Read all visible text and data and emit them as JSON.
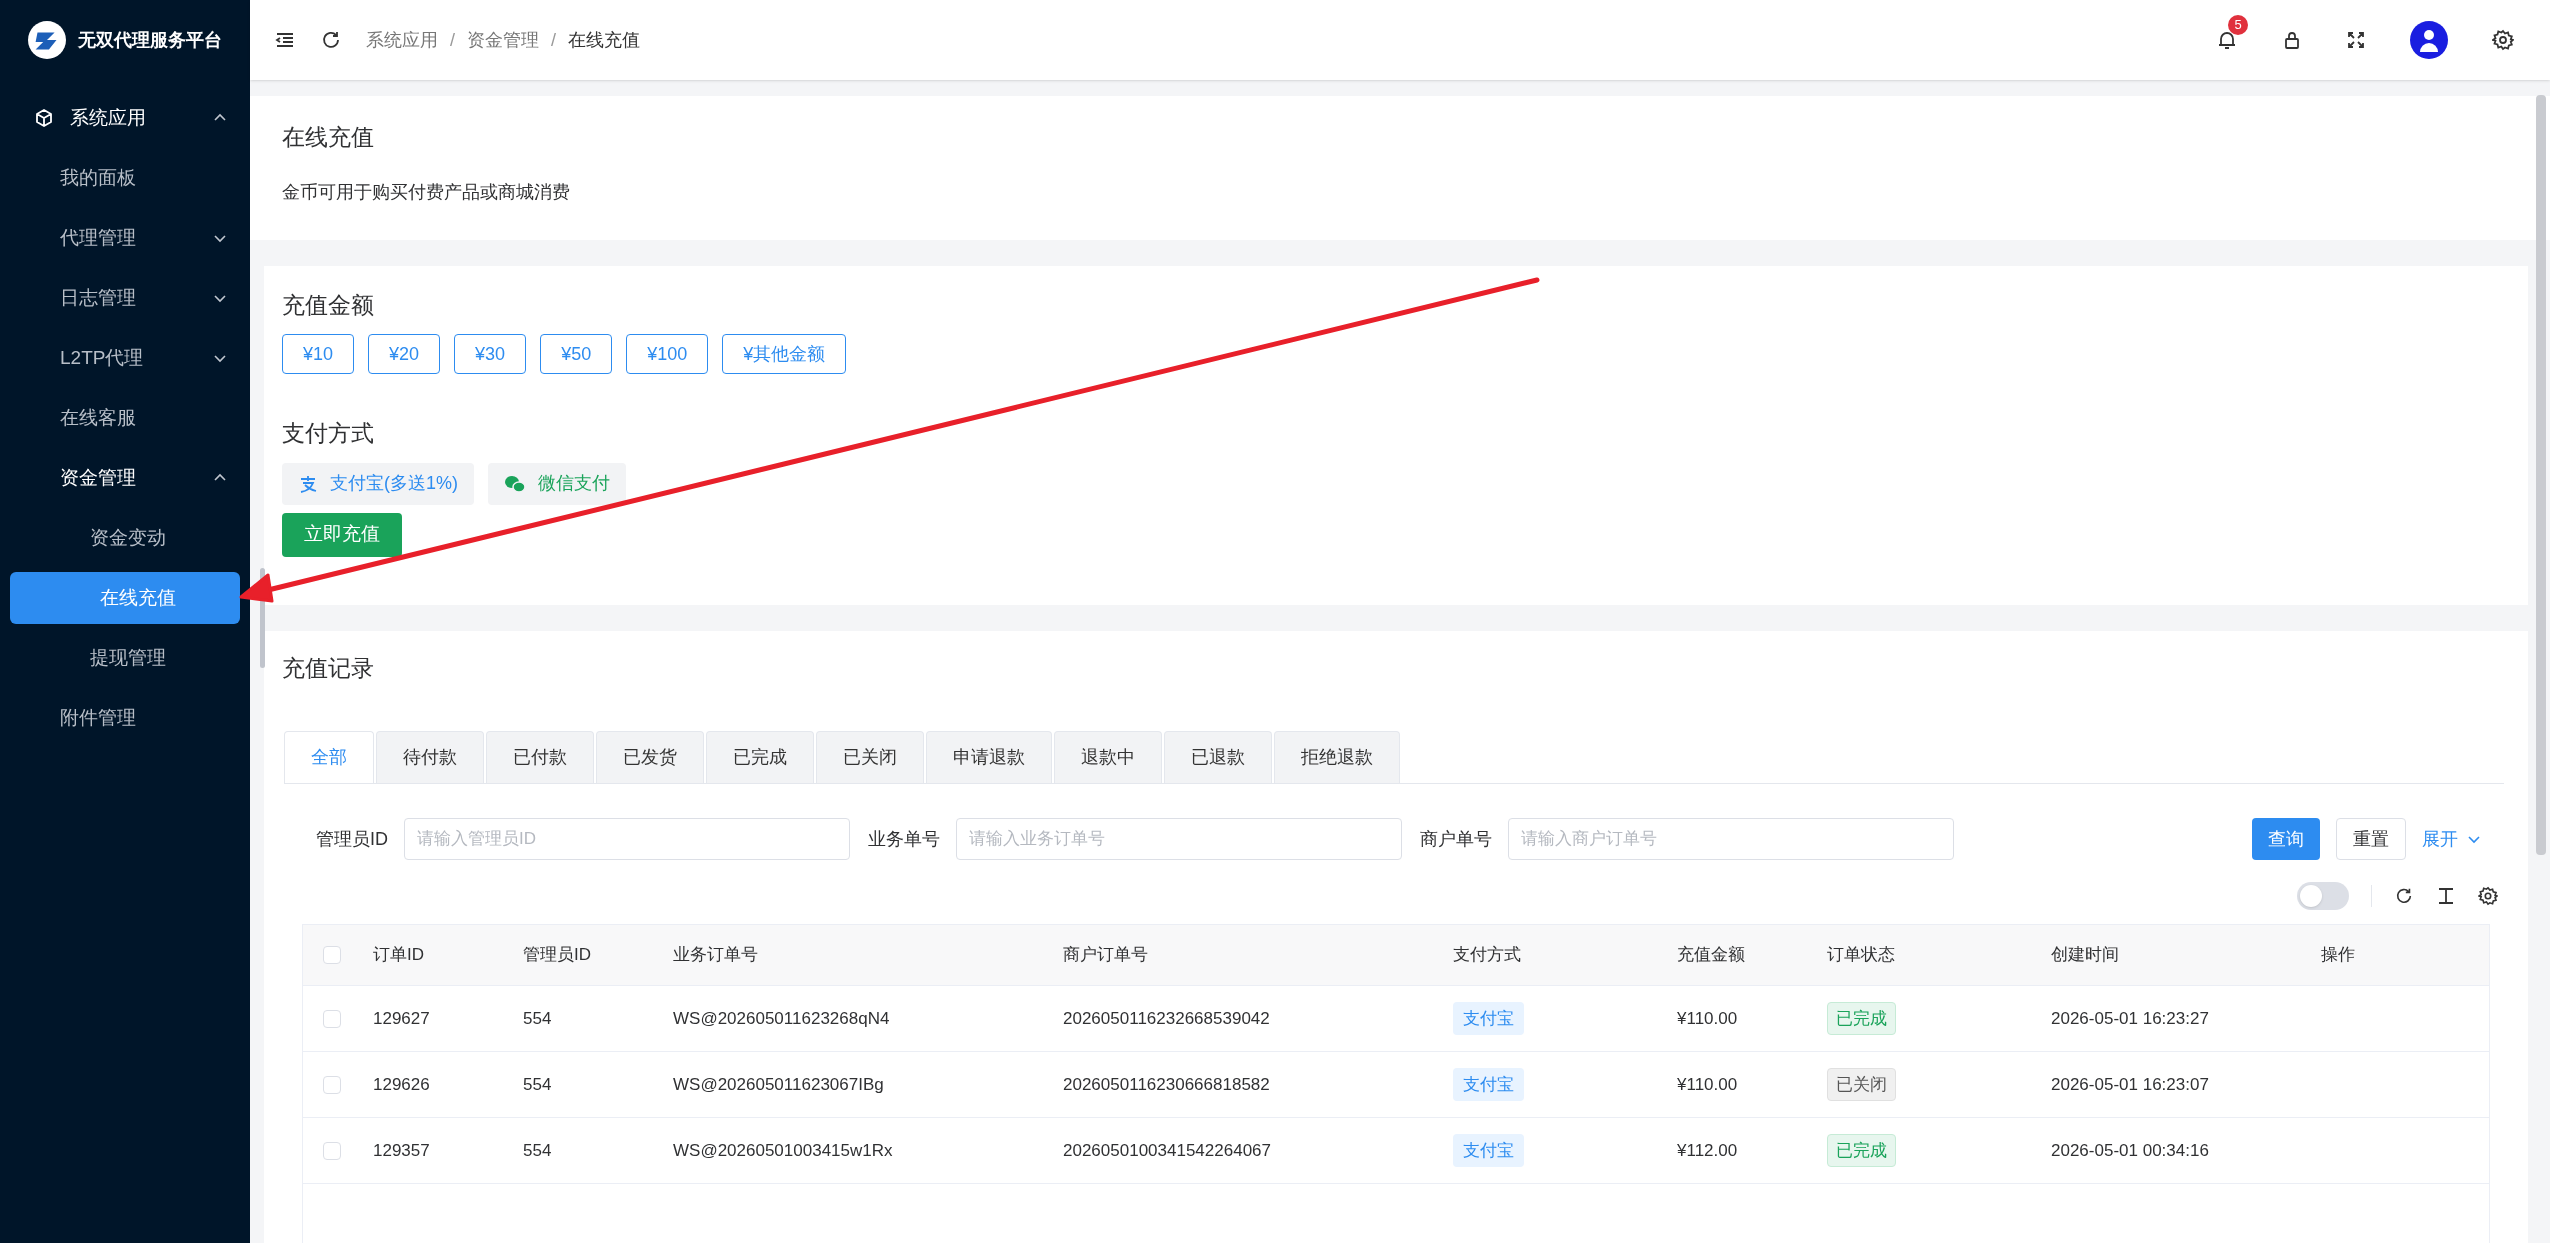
{
  "sidebar": {
    "brand": "无双代理服务平台",
    "items": [
      {
        "label": "系统应用",
        "expanded": true,
        "selected": false,
        "children": [
          {
            "label": "我的面板",
            "selected": false
          },
          {
            "label": "代理管理",
            "expanded": false,
            "selected": false
          },
          {
            "label": "日志管理",
            "expanded": false,
            "selected": false
          },
          {
            "label": "L2TP代理",
            "expanded": false,
            "selected": false
          },
          {
            "label": "在线客服",
            "selected": false
          },
          {
            "label": "资金管理",
            "expanded": true,
            "selected": false,
            "children": [
              {
                "label": "资金变动",
                "selected": false
              },
              {
                "label": "在线充值",
                "selected": true
              },
              {
                "label": "提现管理",
                "selected": false
              }
            ]
          },
          {
            "label": "附件管理",
            "selected": false
          }
        ]
      }
    ]
  },
  "header": {
    "breadcrumb": [
      "系统应用",
      "资金管理",
      "在线充值"
    ],
    "separators": [
      "/",
      "/"
    ],
    "notification_count": "5"
  },
  "intro": {
    "title": "在线充值",
    "description": "金币可用于购买付费产品或商城消费"
  },
  "recharge": {
    "amount_title": "充值金额",
    "amounts": [
      "¥10",
      "¥20",
      "¥30",
      "¥50",
      "¥100",
      "¥其他金额"
    ],
    "payment_title": "支付方式",
    "payments": [
      {
        "label": "支付宝(多送1%)",
        "kind": "alipay"
      },
      {
        "label": "微信支付",
        "kind": "wechat"
      }
    ],
    "submit": "立即充值"
  },
  "records": {
    "title": "充值记录",
    "tabs": [
      {
        "label": "全部",
        "selected": true
      },
      {
        "label": "待付款",
        "selected": false
      },
      {
        "label": "已付款",
        "selected": false
      },
      {
        "label": "已发货",
        "selected": false
      },
      {
        "label": "已完成",
        "selected": false
      },
      {
        "label": "已关闭",
        "selected": false
      },
      {
        "label": "申请退款",
        "selected": false
      },
      {
        "label": "退款中",
        "selected": false
      },
      {
        "label": "已退款",
        "selected": false
      },
      {
        "label": "拒绝退款",
        "selected": false
      }
    ],
    "filters": [
      {
        "label": "管理员ID",
        "placeholder": "请输入管理员ID"
      },
      {
        "label": "业务单号",
        "placeholder": "请输入业务订单号"
      },
      {
        "label": "商户单号",
        "placeholder": "请输入商户订单号"
      }
    ],
    "query": "查询",
    "reset": "重置",
    "expand": "展开",
    "switch_on": false,
    "all_checked": false,
    "columns": [
      "订单ID",
      "管理员ID",
      "业务订单号",
      "商户订单号",
      "支付方式",
      "充值金额",
      "订单状态",
      "创建时间",
      "操作"
    ],
    "rows": [
      {
        "checked": false,
        "cells": [
          "129627",
          "554",
          "WS@202605011623268qN4",
          "2026050116232668539042"
        ],
        "payment": "支付宝",
        "amount": "¥110.00",
        "status": {
          "text": "已完成",
          "kind": "done"
        },
        "created": "2026-05-01 16:23:27"
      },
      {
        "checked": false,
        "cells": [
          "129626",
          "554",
          "WS@202605011623067IBg",
          "2026050116230666818582"
        ],
        "payment": "支付宝",
        "amount": "¥110.00",
        "status": {
          "text": "已关闭",
          "kind": "closed"
        },
        "created": "2026-05-01 16:23:07"
      },
      {
        "checked": false,
        "cells": [
          "129357",
          "554",
          "WS@20260501003415w1Rx",
          "2026050100341542264067"
        ],
        "payment": "支付宝",
        "amount": "¥112.00",
        "status": {
          "text": "已完成",
          "kind": "done"
        },
        "created": "2026-05-01 00:34:16"
      }
    ]
  }
}
